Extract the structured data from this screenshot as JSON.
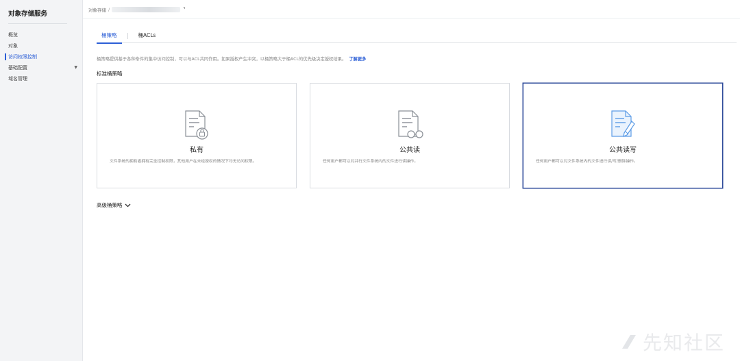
{
  "sidebar": {
    "title": "对象存储服务",
    "items": [
      {
        "label": "概览"
      },
      {
        "label": "对象"
      },
      {
        "label": "访问权限控制"
      },
      {
        "label": "基础配置"
      },
      {
        "label": "域名管理"
      }
    ]
  },
  "breadcrumb": {
    "root": "对象存储",
    "separator": "/",
    "bucket_mark": "⌝"
  },
  "tabs": [
    {
      "label": "桶策略"
    },
    {
      "label": "桶ACLs"
    }
  ],
  "description": {
    "text": "桶策略提供基于各种条件的集中访问控制，可以与ACL共同作用。如果授权产生冲突，以桶策略大于桶ACL的优先级决定授权结果。",
    "link": "了解更多"
  },
  "standard_section": {
    "title": "标准桶策略"
  },
  "cards": [
    {
      "title": "私有",
      "desc": "文件系统的拥有者拥有完全控制权限，其他用户在未经授权的情况下均无访问权限。",
      "icon": "document-lock-icon",
      "selected": false
    },
    {
      "title": "公共读",
      "desc": "任何用户都可以对并行文件系统内的文件进行读操作。",
      "icon": "document-glasses-icon",
      "selected": true
    },
    {
      "title": "公共读写",
      "desc": "任何用户都可以对文件系统内的文件进行读/写/删除操作。",
      "icon": "document-pencil-icon",
      "selected": false
    }
  ],
  "advanced_section": {
    "title": "高级桶策略"
  },
  "watermark": {
    "text": "先知社区"
  },
  "colors": {
    "accent": "#2b5ed6",
    "selected_border": "#2d4a9a",
    "icon_blue": "#5b9be6"
  }
}
